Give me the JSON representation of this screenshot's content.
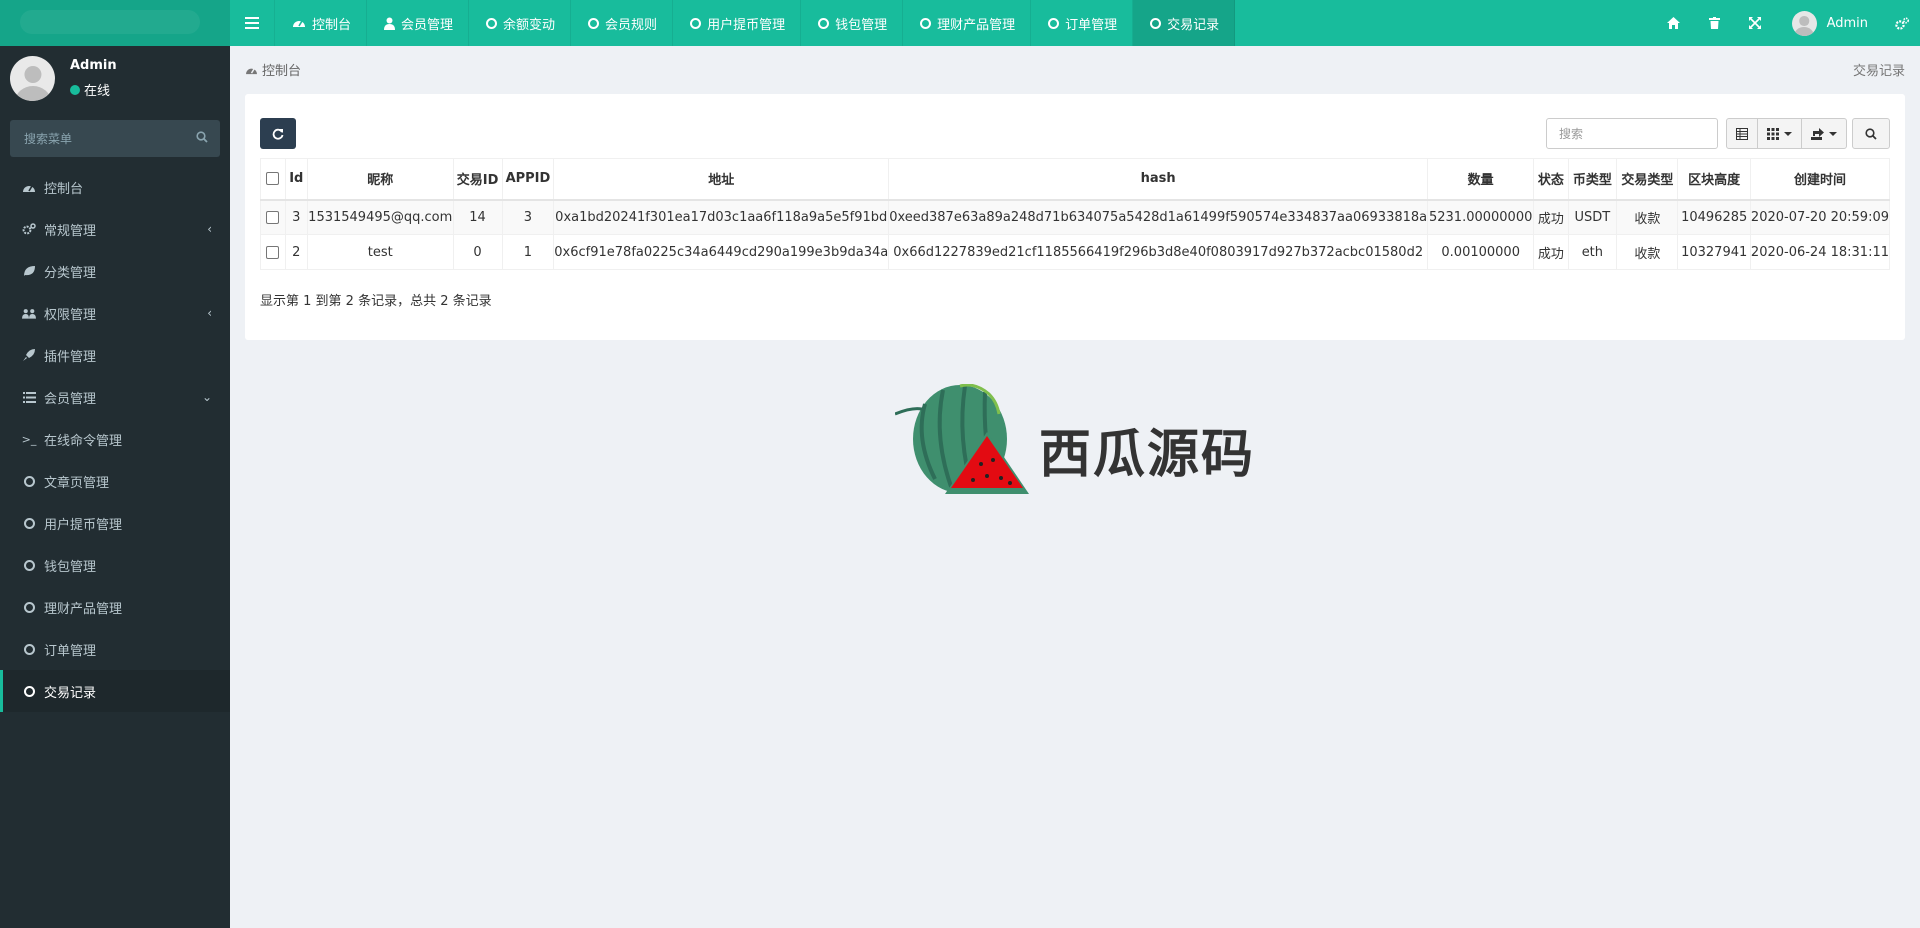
{
  "topnav": {
    "tabs": [
      {
        "label": "控制台",
        "icon": "dashboard-icon"
      },
      {
        "label": "会员管理",
        "icon": "user-icon"
      },
      {
        "label": "余额变动",
        "icon": "circle-icon"
      },
      {
        "label": "会员规则",
        "icon": "circle-icon"
      },
      {
        "label": "用户提币管理",
        "icon": "circle-icon"
      },
      {
        "label": "钱包管理",
        "icon": "circle-icon"
      },
      {
        "label": "理财产品管理",
        "icon": "circle-icon"
      },
      {
        "label": "订单管理",
        "icon": "circle-icon"
      },
      {
        "label": "交易记录",
        "icon": "circle-icon",
        "active": true
      }
    ],
    "user_name": "Admin"
  },
  "sidebar": {
    "user": {
      "name": "Admin",
      "status": "在线"
    },
    "search_placeholder": "搜索菜单",
    "items": [
      {
        "label": "控制台",
        "icon": "dashboard-icon"
      },
      {
        "label": "常规管理",
        "icon": "cogs-icon",
        "arrow": "‹"
      },
      {
        "label": "分类管理",
        "icon": "leaf-icon"
      },
      {
        "label": "权限管理",
        "icon": "group-icon",
        "arrow": "‹"
      },
      {
        "label": "插件管理",
        "icon": "rocket-icon"
      },
      {
        "label": "会员管理",
        "icon": "list-icon",
        "arrow": "⌄"
      },
      {
        "label": "在线命令管理",
        "icon": "terminal-icon"
      },
      {
        "label": "文章页管理",
        "icon": "circle-icon"
      },
      {
        "label": "用户提币管理",
        "icon": "circle-icon"
      },
      {
        "label": "钱包管理",
        "icon": "circle-icon"
      },
      {
        "label": "理财产品管理",
        "icon": "circle-icon"
      },
      {
        "label": "订单管理",
        "icon": "circle-icon"
      },
      {
        "label": "交易记录",
        "icon": "circle-icon",
        "active": true
      }
    ]
  },
  "breadcrumb": {
    "home": "控制台",
    "current": "交易记录"
  },
  "toolbar": {
    "search_placeholder": "搜索"
  },
  "table": {
    "headers": [
      "Id",
      "昵称",
      "交易ID",
      "APPID",
      "地址",
      "hash",
      "数量",
      "状态",
      "币类型",
      "交易类型",
      "区块高度",
      "创建时间"
    ],
    "rows": [
      [
        "3",
        "1531549495@qq.com",
        "14",
        "3",
        "0xa1bd20241f301ea17d03c1aa6f118a9a5e5f91bd",
        "0xeed387e63a89a248d71b634075a5428d1a61499f590574e334837aa06933818a",
        "5231.00000000",
        "成功",
        "USDT",
        "收款",
        "10496285",
        "2020-07-20 20:59:09"
      ],
      [
        "2",
        "test",
        "0",
        "1",
        "0x6cf91e78fa0225c34a6449cd290a199e3b9da34a",
        "0x66d1227839ed21cf1185566419f296b3d8e40f0803917d927b372acbc01580d2",
        "0.00100000",
        "成功",
        "eth",
        "收款",
        "10327941",
        "2020-06-24 18:31:11"
      ]
    ]
  },
  "pager": {
    "info": "显示第 1 到第 2 条记录，总共 2 条记录"
  },
  "watermark": {
    "text": "西瓜源码"
  },
  "colors": {
    "brand": "#18bc9c",
    "sidebar": "#222d32",
    "link": "#3c8dbc",
    "danger": "#e74c3c"
  }
}
